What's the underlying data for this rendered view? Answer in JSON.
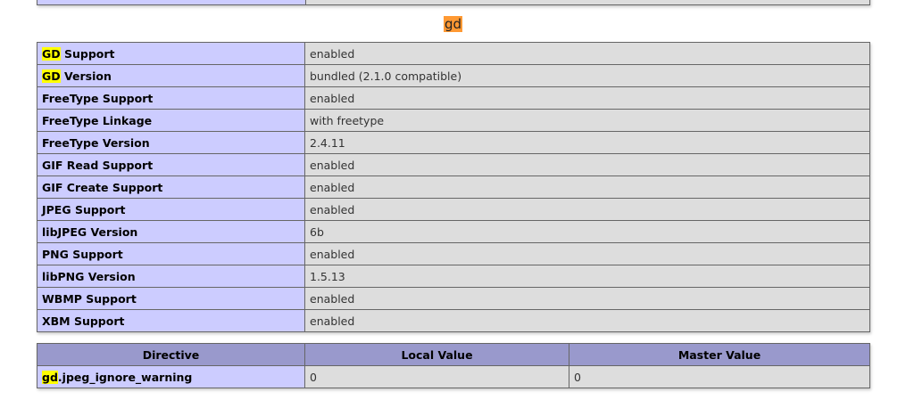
{
  "section_title": "gd",
  "highlight_color": "#ffff00",
  "title_highlight_color": "#ff9933",
  "info_rows": [
    {
      "hl": "GD",
      "label": " Support",
      "value": "enabled"
    },
    {
      "hl": "GD",
      "label": " Version",
      "value": "bundled (2.1.0 compatible)"
    },
    {
      "hl": "",
      "label": "FreeType Support",
      "value": "enabled"
    },
    {
      "hl": "",
      "label": "FreeType Linkage",
      "value": "with freetype"
    },
    {
      "hl": "",
      "label": "FreeType Version",
      "value": "2.4.11"
    },
    {
      "hl": "",
      "label": "GIF Read Support",
      "value": "enabled"
    },
    {
      "hl": "",
      "label": "GIF Create Support",
      "value": "enabled"
    },
    {
      "hl": "",
      "label": "JPEG Support",
      "value": "enabled"
    },
    {
      "hl": "",
      "label": "libJPEG Version",
      "value": "6b"
    },
    {
      "hl": "",
      "label": "PNG Support",
      "value": "enabled"
    },
    {
      "hl": "",
      "label": "libPNG Version",
      "value": "1.5.13"
    },
    {
      "hl": "",
      "label": "WBMP Support",
      "value": "enabled"
    },
    {
      "hl": "",
      "label": "XBM Support",
      "value": "enabled"
    }
  ],
  "directive_table": {
    "headers": [
      "Directive",
      "Local Value",
      "Master Value"
    ],
    "rows": [
      {
        "hl": "gd",
        "name": ".jpeg_ignore_warning",
        "local": "0",
        "master": "0"
      }
    ]
  }
}
